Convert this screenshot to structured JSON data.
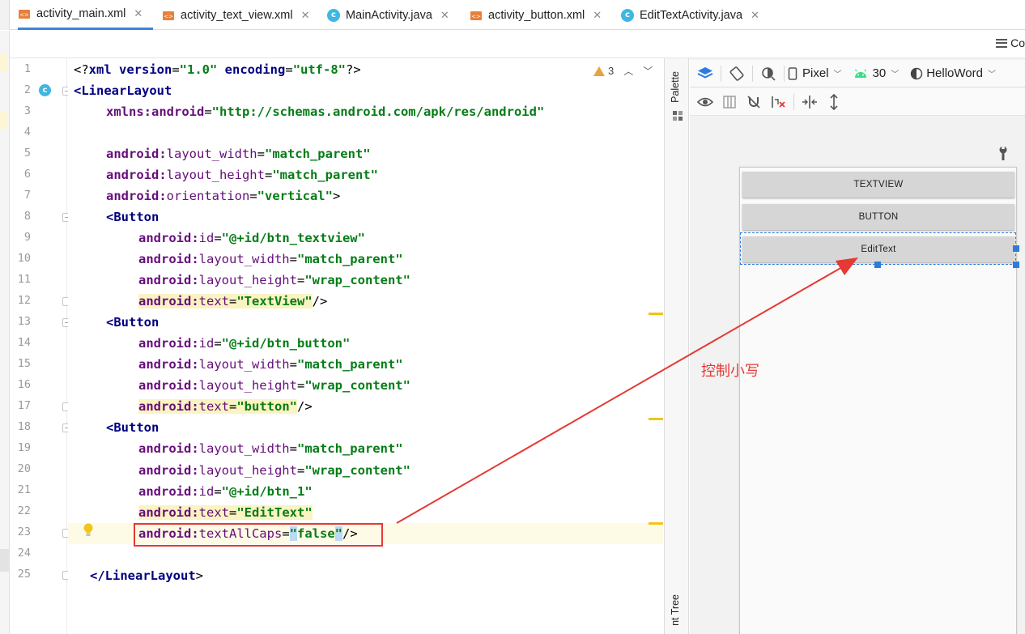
{
  "tabs": [
    {
      "label": "activity_main.xml",
      "type": "xml",
      "active": true
    },
    {
      "label": "activity_text_view.xml",
      "type": "xml",
      "active": false
    },
    {
      "label": "MainActivity.java",
      "type": "java",
      "active": false
    },
    {
      "label": "activity_button.xml",
      "type": "xml",
      "active": false
    },
    {
      "label": "EditTextActivity.java",
      "type": "java",
      "active": false
    }
  ],
  "right_toolbar": {
    "label": "Co"
  },
  "editor": {
    "line_numbers": [
      "1",
      "2",
      "3",
      "4",
      "5",
      "6",
      "7",
      "8",
      "9",
      "10",
      "11",
      "12",
      "13",
      "14",
      "15",
      "16",
      "17",
      "18",
      "19",
      "20",
      "21",
      "22",
      "23",
      "24",
      "25"
    ],
    "warning_count": "3",
    "lines": {
      "l1": {
        "p1": "<?",
        "tag": "xml",
        "a1": " version",
        "eq1": "=",
        "v1": "\"1.0\"",
        "a2": " encoding",
        "eq2": "=",
        "v2": "\"utf-8\"",
        "p2": "?>"
      },
      "l2": {
        "tag": "<LinearLayout"
      },
      "l3": {
        "ns": "xmlns:android",
        "eq": "=",
        "val": "\"http://schemas.android.com/apk/res/android\""
      },
      "l5": {
        "ns": "android:",
        "attr": "layout_width",
        "eq": "=",
        "val": "\"match_parent\""
      },
      "l6": {
        "ns": "android:",
        "attr": "layout_height",
        "eq": "=",
        "val": "\"match_parent\""
      },
      "l7": {
        "ns": "android:",
        "attr": "orientation",
        "eq": "=",
        "val": "\"vertical\"",
        "end": ">"
      },
      "l8": {
        "tag": "<Button"
      },
      "l9": {
        "ns": "android:",
        "attr": "id",
        "eq": "=",
        "val": "\"@+id/btn_textview\""
      },
      "l10": {
        "ns": "android:",
        "attr": "layout_width",
        "eq": "=",
        "val": "\"match_parent\""
      },
      "l11": {
        "ns": "android:",
        "attr": "layout_height",
        "eq": "=",
        "val": "\"wrap_content\""
      },
      "l12": {
        "ns": "android:",
        "attr": "text",
        "eq": "=",
        "val": "\"TextView\"",
        "end": "/>"
      },
      "l13": {
        "tag": "<Button"
      },
      "l14": {
        "ns": "android:",
        "attr": "id",
        "eq": "=",
        "val": "\"@+id/btn_button\""
      },
      "l15": {
        "ns": "android:",
        "attr": "layout_width",
        "eq": "=",
        "val": "\"match_parent\""
      },
      "l16": {
        "ns": "android:",
        "attr": "layout_height",
        "eq": "=",
        "val": "\"wrap_content\""
      },
      "l17": {
        "ns": "android:",
        "attr": "text",
        "eq": "=",
        "val": "\"button\"",
        "end": "/>"
      },
      "l18": {
        "tag": "<Button"
      },
      "l19": {
        "ns": "android:",
        "attr": "layout_width",
        "eq": "=",
        "val": "\"match_parent\""
      },
      "l20": {
        "ns": "android:",
        "attr": "layout_height",
        "eq": "=",
        "val": "\"wrap_content\""
      },
      "l21": {
        "ns": "android:",
        "attr": "id",
        "eq": "=",
        "val": "\"@+id/btn_1\""
      },
      "l22": {
        "ns": "android:",
        "attr": "text",
        "eq": "=",
        "val": "\"EditText\""
      },
      "l23": {
        "ns": "android:",
        "attr": "textAllCaps",
        "eq": "=",
        "q1": "\"",
        "val": "false",
        "q2": "\"",
        "end": "/>"
      },
      "l25": {
        "tag": "</LinearLayout",
        "end": ">"
      }
    }
  },
  "palette": {
    "label": "Palette",
    "tree_label": "nt Tree"
  },
  "design": {
    "device": "Pixel",
    "api": "30",
    "theme": "HelloWord",
    "preview_buttons": [
      "TEXTVIEW",
      "BUTTON",
      "EditText"
    ]
  },
  "annotation": {
    "text": "控制小写"
  },
  "colors": {
    "accent": "#3d85d9",
    "annotation": "#e53935",
    "selection": "#2f7bdc",
    "string": "#067d17",
    "attr": "#660e7a",
    "tag": "#000080"
  }
}
